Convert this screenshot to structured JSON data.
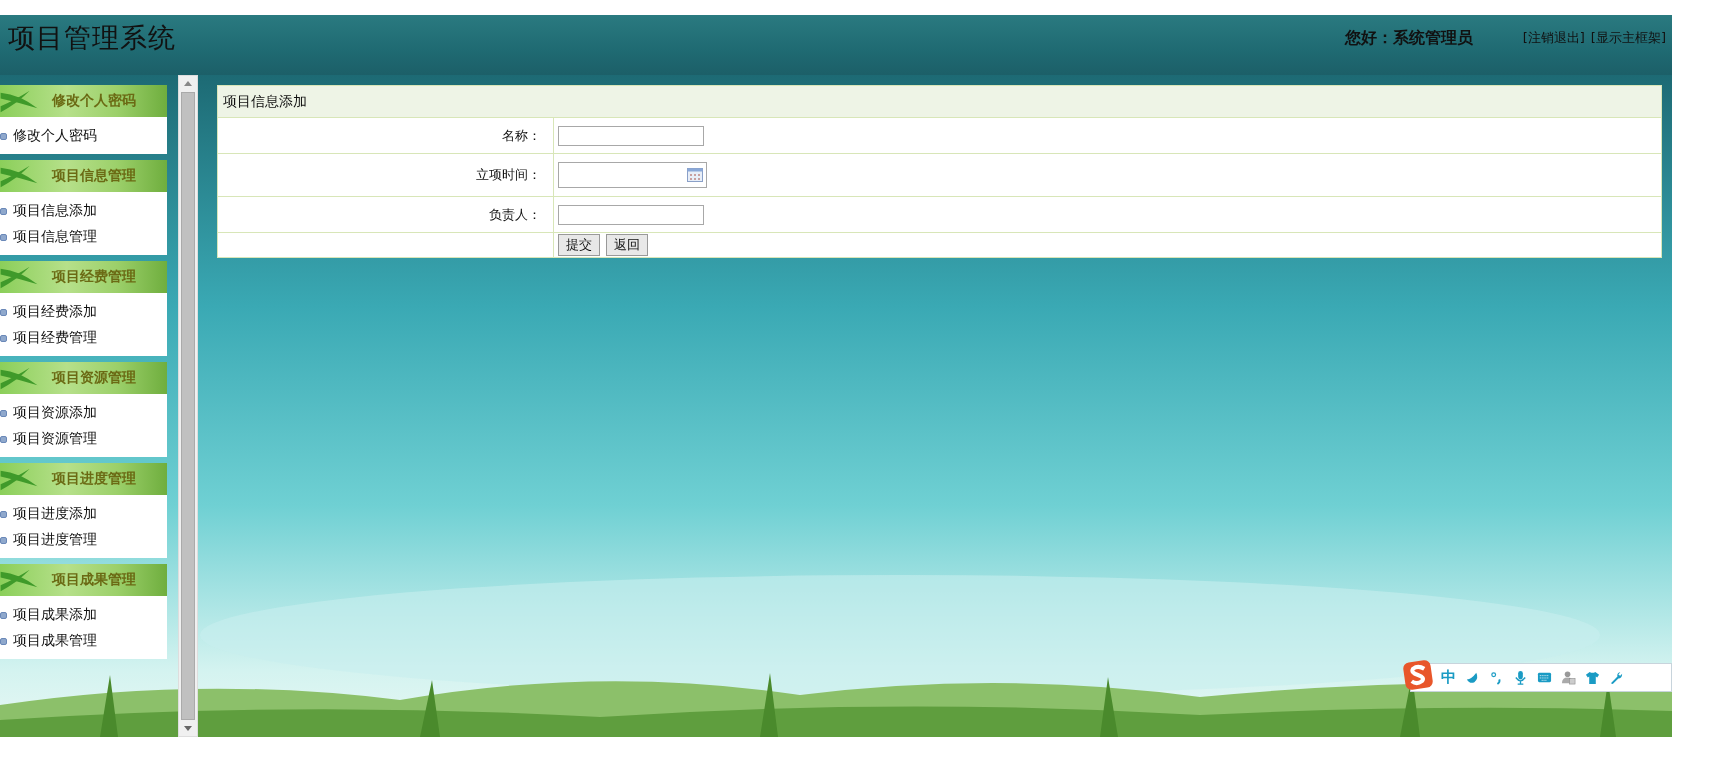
{
  "header": {
    "title": "项目管理系统",
    "greeting": "您好：系统管理员",
    "links": [
      "[注销退出]",
      "[显示主框架]"
    ]
  },
  "sidebar": {
    "groups": [
      {
        "title": "修改个人密码",
        "items": [
          "修改个人密码"
        ]
      },
      {
        "title": "项目信息管理",
        "items": [
          "项目信息添加",
          "项目信息管理"
        ]
      },
      {
        "title": "项目经费管理",
        "items": [
          "项目经费添加",
          "项目经费管理"
        ]
      },
      {
        "title": "项目资源管理",
        "items": [
          "项目资源添加",
          "项目资源管理"
        ]
      },
      {
        "title": "项目进度管理",
        "items": [
          "项目进度添加",
          "项目进度管理"
        ]
      },
      {
        "title": "项目成果管理",
        "items": [
          "项目成果添加",
          "项目成果管理"
        ]
      }
    ]
  },
  "form": {
    "title": "项目信息添加",
    "fields": [
      {
        "label": "名称：",
        "kind": "text"
      },
      {
        "label": "立项时间：",
        "kind": "date"
      },
      {
        "label": "负责人：",
        "kind": "text"
      }
    ],
    "buttons": [
      "提交",
      "返回"
    ]
  },
  "ime_toolbar": {
    "mode": "中"
  }
}
